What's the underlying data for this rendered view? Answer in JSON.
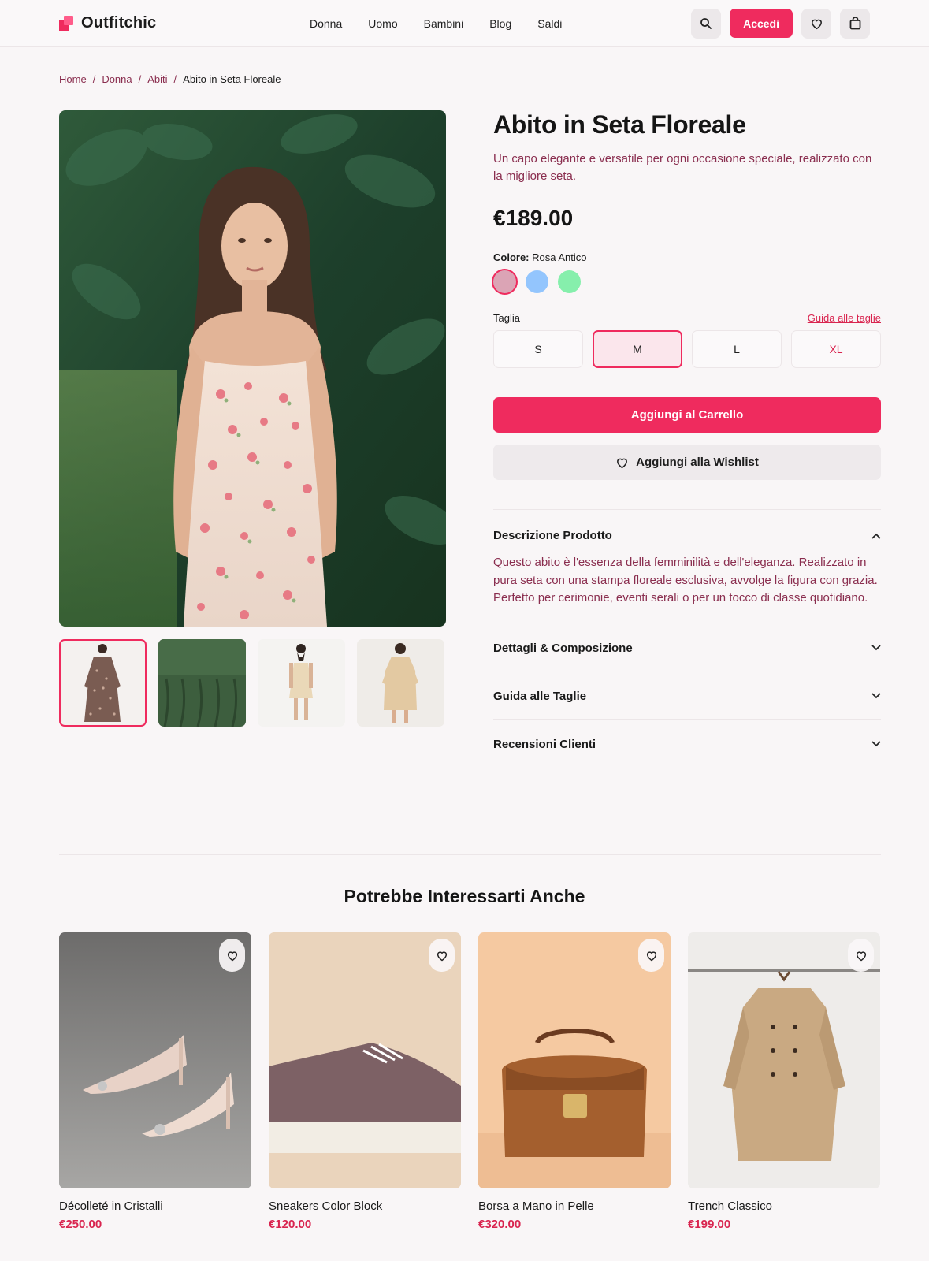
{
  "brand": {
    "name": "Outfitchic",
    "accent": "#ef2b5e"
  },
  "nav": {
    "items": [
      "Donna",
      "Uomo",
      "Bambini",
      "Blog",
      "Saldi"
    ],
    "login_label": "Accedi",
    "icons": [
      "search-icon",
      "heart-icon",
      "shopping-bag-icon"
    ]
  },
  "breadcrumb": {
    "items": [
      "Home",
      "Donna",
      "Abiti"
    ],
    "current": "Abito in Seta Floreale",
    "separator": "/"
  },
  "product": {
    "title": "Abito in Seta Floreale",
    "subtitle": "Un capo elegante e versatile per ogni occasione speciale, realizzato con la migliore seta.",
    "price": "€189.00",
    "color_label": "Colore:",
    "color_value": "Rosa Antico",
    "colors": [
      {
        "name": "Rosa Antico",
        "hex": "#dba4b5",
        "selected": true
      },
      {
        "name": "Azzurro",
        "hex": "#93c5fd",
        "selected": false
      },
      {
        "name": "Verde Menta",
        "hex": "#86efac",
        "selected": false
      }
    ],
    "size_label": "Taglia",
    "size_guide_link": "Guida alle taglie",
    "sizes": [
      {
        "label": "S",
        "selected": false
      },
      {
        "label": "M",
        "selected": true
      },
      {
        "label": "L",
        "selected": false
      },
      {
        "label": "XL",
        "selected": false
      }
    ],
    "add_to_cart": "Aggiungi al Carrello",
    "add_to_wishlist": "Aggiungi alla Wishlist",
    "thumbnails": [
      "thumb-floral-long-dress",
      "thumb-green-fabric",
      "thumb-beige-dress-back",
      "thumb-beige-dress-front"
    ]
  },
  "accordion": [
    {
      "title": "Descrizione Prodotto",
      "open": true,
      "body": "Questo abito è l'essenza della femminilità e dell'eleganza. Realizzato in pura seta con una stampa floreale esclusiva, avvolge la figura con grazia. Perfetto per cerimonie, eventi serali o per un tocco di classe quotidiano."
    },
    {
      "title": "Dettagli & Composizione",
      "open": false
    },
    {
      "title": "Guida alle Taglie",
      "open": false
    },
    {
      "title": "Recensioni Clienti",
      "open": false
    }
  ],
  "recommendations": {
    "title": "Potrebbe Interessarti Anche",
    "items": [
      {
        "name": "Décolleté in Cristalli",
        "price": "€250.00"
      },
      {
        "name": "Sneakers Color Block",
        "price": "€120.00"
      },
      {
        "name": "Borsa a Mano in Pelle",
        "price": "€320.00"
      },
      {
        "name": "Trench Classico",
        "price": "€199.00"
      }
    ]
  }
}
